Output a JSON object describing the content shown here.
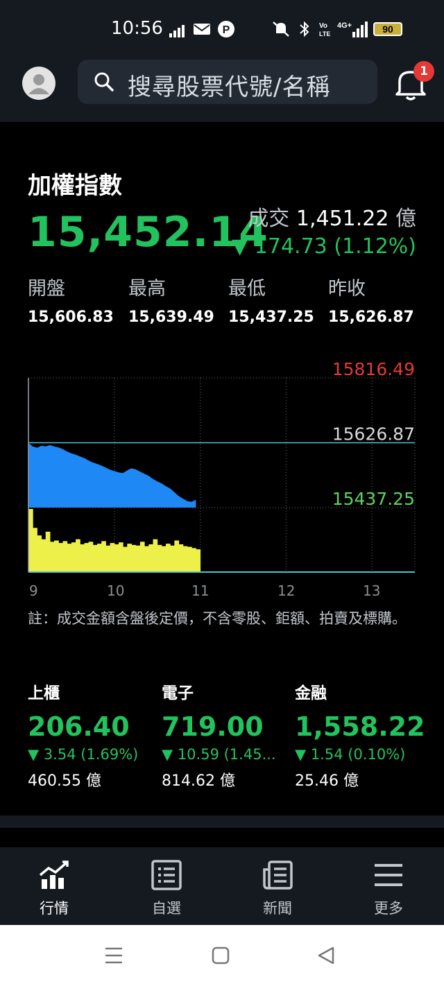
{
  "status_bar": {
    "time": "10:56",
    "battery": "90"
  },
  "search": {
    "placeholder": "搜尋股票代號/名稱"
  },
  "notifications": {
    "count": "1"
  },
  "index": {
    "name": "加權指數",
    "value": "15,452.14",
    "turnover_label": "成交",
    "turnover_value": "1,451.22",
    "turnover_unit": "億",
    "change": "▼ 174.73 (1.12%)"
  },
  "stats": [
    {
      "label": "開盤",
      "value": "15,606.83"
    },
    {
      "label": "最高",
      "value": "15,639.49"
    },
    {
      "label": "最低",
      "value": "15,437.25"
    },
    {
      "label": "昨收",
      "value": "15,626.87"
    }
  ],
  "chart_data": {
    "type": "area",
    "y_labels": {
      "top": {
        "text": "15816.49",
        "color": "#e53935"
      },
      "mid": {
        "text": "15626.87",
        "color": "#d8d8d8"
      },
      "low": {
        "text": "15437.25",
        "color": "#5fd35f"
      }
    },
    "ylim": [
      15437.25,
      15816.49
    ],
    "reference_line": 15626.87,
    "x_ticks": [
      "9",
      "10",
      "11",
      "12",
      "13"
    ],
    "xlim": [
      9.0,
      13.5
    ],
    "grid": true,
    "price_color": "#1e88f5",
    "volume_color": "#eef04a",
    "price_series": {
      "name": "",
      "x": [
        9.0,
        9.05,
        9.1,
        9.15,
        9.2,
        9.25,
        9.3,
        9.35,
        9.4,
        9.45,
        9.5,
        9.55,
        9.6,
        9.65,
        9.7,
        9.75,
        9.8,
        9.85,
        9.9,
        9.95,
        10.0,
        10.05,
        10.1,
        10.15,
        10.2,
        10.25,
        10.3,
        10.35,
        10.4,
        10.45,
        10.5,
        10.55,
        10.6,
        10.65,
        10.7,
        10.75,
        10.8,
        10.85,
        10.9,
        10.95
      ],
      "values": [
        15626,
        15616,
        15612,
        15618,
        15616,
        15620,
        15616,
        15613,
        15608,
        15601,
        15596,
        15592,
        15587,
        15582,
        15575,
        15569,
        15565,
        15560,
        15554,
        15548,
        15544,
        15540,
        15538,
        15546,
        15552,
        15549,
        15542,
        15536,
        15530,
        15521,
        15514,
        15508,
        15500,
        15493,
        15482,
        15471,
        15463,
        15456,
        15454,
        15460
      ]
    },
    "volume_series": {
      "name": "",
      "values": [
        100,
        70,
        58,
        52,
        64,
        48,
        50,
        46,
        49,
        45,
        47,
        52,
        44,
        46,
        48,
        43,
        45,
        49,
        42,
        46,
        44,
        47,
        40,
        45,
        43,
        42,
        48,
        41,
        44,
        52,
        43,
        41,
        45,
        42,
        50,
        44,
        41,
        40,
        38,
        36
      ]
    }
  },
  "note": "註：成交金額含盤後定價，不含零股、鉅額、拍賣及標購。",
  "sub_indices": [
    {
      "name": "上櫃",
      "value": "206.40",
      "change": "▼ 3.54 (1.69%)",
      "volume": "460.55 億"
    },
    {
      "name": "電子",
      "value": "719.00",
      "change": "▼ 10.59 (1.45...",
      "volume": "814.62 億"
    },
    {
      "name": "金融",
      "value": "1,558.22",
      "change": "▼ 1.54 (0.10%)",
      "volume": "25.46 億"
    }
  ],
  "nav": [
    {
      "label": "行情",
      "icon": "chart-icon"
    },
    {
      "label": "自選",
      "icon": "list-icon"
    },
    {
      "label": "新聞",
      "icon": "news-icon"
    },
    {
      "label": "更多",
      "icon": "menu-icon"
    }
  ]
}
